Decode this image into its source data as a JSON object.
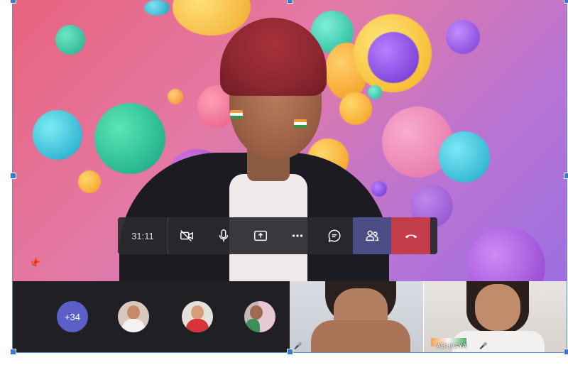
{
  "call": {
    "timer": "31:11",
    "more_participants": "+34"
  },
  "controls": [
    {
      "name": "camera-off",
      "icon": "camera-off-icon"
    },
    {
      "name": "microphone",
      "icon": "microphone-icon"
    },
    {
      "name": "share-screen",
      "icon": "share-tray-icon"
    },
    {
      "name": "more-actions",
      "icon": "ellipsis-icon"
    },
    {
      "name": "chat",
      "icon": "chat-bubble-icon"
    },
    {
      "name": "participants",
      "icon": "people-icon"
    },
    {
      "name": "hang-up",
      "icon": "phone-hangup-icon"
    }
  ],
  "tiles": [
    {
      "label": ""
    },
    {
      "label": "ABHIGYA"
    }
  ],
  "colors": {
    "control_bar": "#29282e",
    "participants_active": "#4c4d86",
    "hangup": "#c43d4b",
    "badge": "#5b5fc7",
    "strip": "#201f23",
    "selection": "#3a78d8"
  }
}
